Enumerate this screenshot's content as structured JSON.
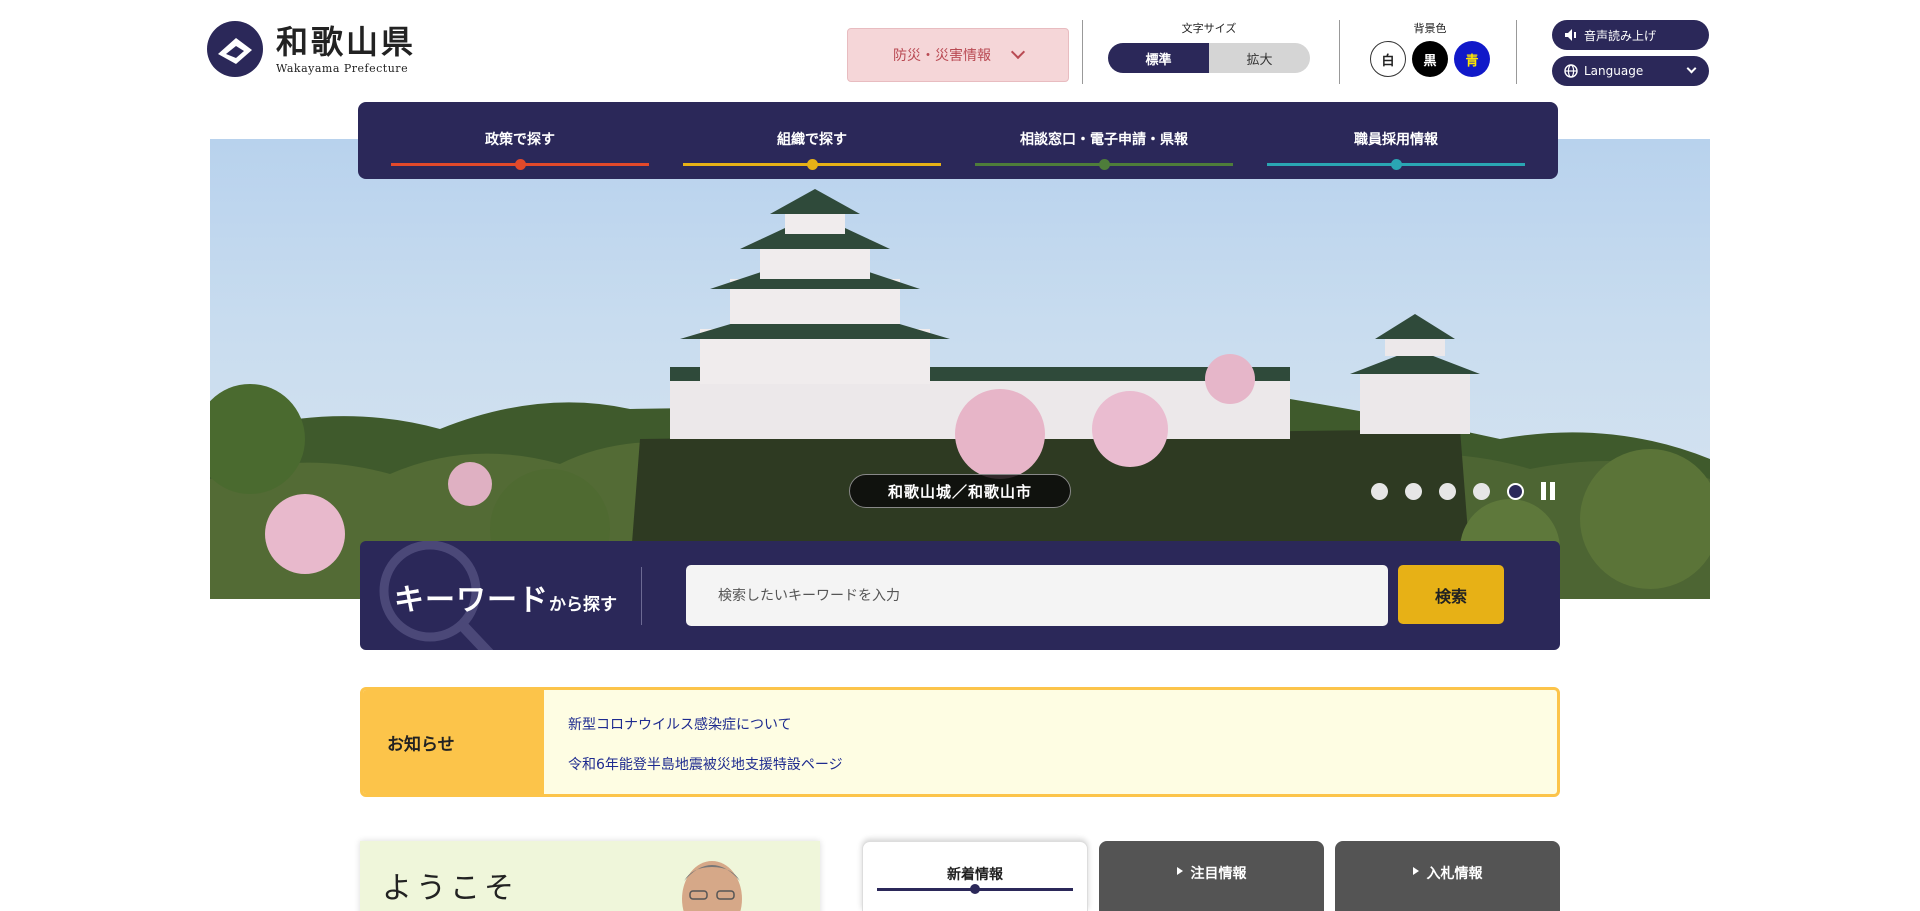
{
  "header": {
    "logo": {
      "title": "和歌山県",
      "subtitle": "Wakayama Prefecture"
    },
    "disaster_button": "防災・災害情報",
    "font_size": {
      "label": "文字サイズ",
      "standard": "標準",
      "large": "拡大"
    },
    "background_color": {
      "label": "背景色",
      "white": "白",
      "black": "黒",
      "blue": "青"
    },
    "read_aloud": "音声読み上げ",
    "language": "Language"
  },
  "global_nav": [
    {
      "label": "政策で探す",
      "color": "#e2492a"
    },
    {
      "label": "組織で探す",
      "color": "#e7b116"
    },
    {
      "label": "相談窓口・電子申請・県報",
      "color": "#4e7d3a"
    },
    {
      "label": "職員採用情報",
      "color": "#2aa6b3"
    }
  ],
  "hero": {
    "caption": "和歌山城／和歌山市",
    "slide_count": 5,
    "active_slide": 5
  },
  "search": {
    "title_main": "キーワード",
    "title_sub": "から探す",
    "placeholder": "検索したいキーワードを入力",
    "button": "検索"
  },
  "notice": {
    "label": "お知らせ",
    "items": [
      "新型コロナウイルス感染症について",
      "令和6年能登半島地震被災地支援特設ページ"
    ]
  },
  "welcome": {
    "title": "ようこそ"
  },
  "tabs": [
    {
      "label": "新着情報"
    },
    {
      "label": "注目情報"
    },
    {
      "label": "入札情報"
    }
  ],
  "colors": {
    "navy": "#2b2859",
    "gold": "#e7b116",
    "notice_yellow": "#fcc44a"
  }
}
